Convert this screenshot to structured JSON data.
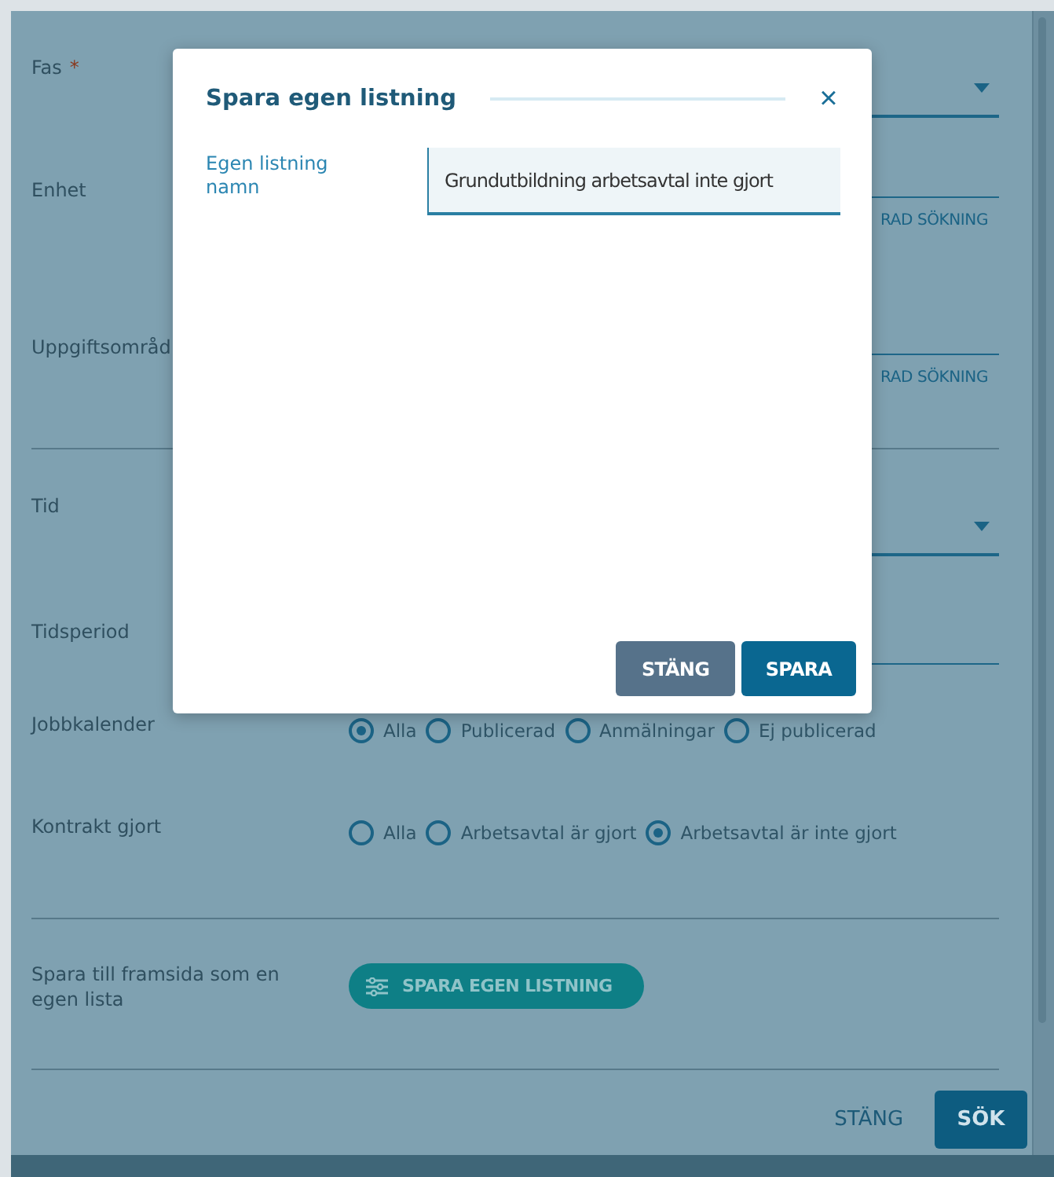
{
  "form": {
    "fields": [
      {
        "kind": "dropdown",
        "label": "Fas",
        "required_mark": "*"
      },
      {
        "kind": "search",
        "label": "Enhet",
        "link": "RAD SÖKNING"
      },
      {
        "kind": "search",
        "label": "Uppgiftsområd",
        "link": "RAD SÖKNING"
      },
      {
        "kind": "divider"
      },
      {
        "kind": "dropdown",
        "label": "Tid"
      },
      {
        "kind": "input",
        "label": "Tidsperiod"
      },
      {
        "kind": "radios",
        "label": "Jobbkalender",
        "options": [
          {
            "label": "Alla",
            "selected": true
          },
          {
            "label": "Publicerad",
            "selected": false
          },
          {
            "label": "Anmälningar",
            "selected": false
          },
          {
            "label": "Ej publicerad",
            "selected": false
          }
        ]
      },
      {
        "kind": "radios",
        "label": "Kontrakt gjort",
        "options": [
          {
            "label": "Alla",
            "selected": false
          },
          {
            "label": "Arbetsavtal är gjort",
            "selected": false
          },
          {
            "label": "Arbetsavtal är inte gjort",
            "selected": true
          }
        ]
      },
      {
        "kind": "divider"
      },
      {
        "kind": "action",
        "label": "Spara till framsida som en egen lista",
        "button": "SPARA EGEN LISTNING"
      },
      {
        "kind": "divider"
      }
    ],
    "buttons": [
      {
        "kind": "text",
        "label": "STÄNG"
      },
      {
        "kind": "primary",
        "label": "SÖK"
      }
    ]
  },
  "dialog": {
    "title": "Spara egen listning",
    "close": "×",
    "field": {
      "label": "Egen listning namn",
      "value": "Grundutbildning arbetsavtal inte gjort"
    },
    "buttons": [
      {
        "kind": "secondary",
        "label": "STÄNG"
      },
      {
        "kind": "primary",
        "label": "SPARA"
      }
    ]
  }
}
